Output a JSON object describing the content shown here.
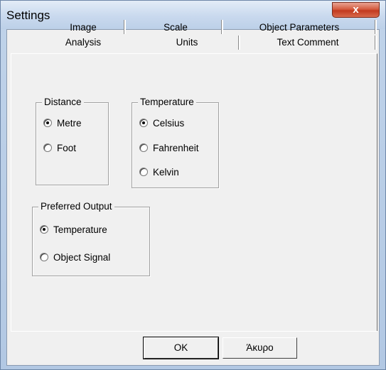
{
  "window": {
    "title": "Settings",
    "close_symbol": "x"
  },
  "tabs_row1": [
    {
      "label": "Image"
    },
    {
      "label": "Scale"
    },
    {
      "label": "Object Parameters"
    }
  ],
  "tabs_row2": [
    {
      "label": "Analysis"
    },
    {
      "label": "Units",
      "selected": true
    },
    {
      "label": "Text Comment"
    }
  ],
  "distance": {
    "title": "Distance",
    "options": [
      {
        "label": "Metre",
        "checked": true
      },
      {
        "label": "Foot",
        "checked": false
      }
    ]
  },
  "temperature": {
    "title": "Temperature",
    "options": [
      {
        "label": "Celsius",
        "checked": true
      },
      {
        "label": "Fahrenheit",
        "checked": false
      },
      {
        "label": "Kelvin",
        "checked": false
      }
    ]
  },
  "preferred_output": {
    "title": "Preferred Output",
    "options": [
      {
        "label": "Temperature",
        "checked": true
      },
      {
        "label": "Object Signal",
        "checked": false
      }
    ]
  },
  "buttons": {
    "ok": "OK",
    "cancel": "Άκυρο"
  }
}
